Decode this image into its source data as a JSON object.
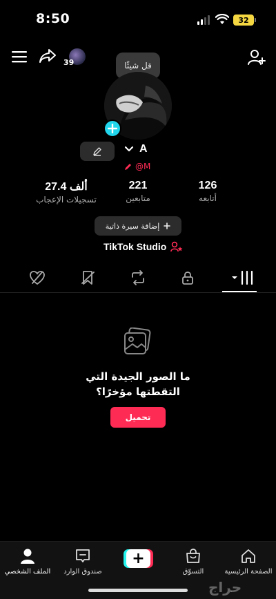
{
  "status_bar": {
    "time": "8:50",
    "battery": "32"
  },
  "top_bar": {
    "story_count": "39"
  },
  "note_bubble": "قل شيئًا",
  "profile": {
    "name": "A",
    "username": "@M"
  },
  "stats": {
    "following": {
      "value": "126",
      "label": "أتابعه"
    },
    "followers": {
      "value": "221",
      "label": "متابعين"
    },
    "likes": {
      "value": "27.4 ألف",
      "label": "تسجيلات الإعجاب"
    }
  },
  "bio_button": {
    "label": "إضافة سيرة ذاتية",
    "icon": "plus-icon"
  },
  "studio": {
    "label": "TikTok Studio"
  },
  "tabs": [
    "videos-grid-icon",
    "lock-icon",
    "repost-icon",
    "favorites-icon",
    "liked-icon"
  ],
  "empty_state": {
    "line1": "ما الصور الجيدة التي",
    "line2": "التقطتها مؤخرًا؟",
    "upload_label": "تحميل"
  },
  "bottom_nav": {
    "home": "الصفحة الرئيسية",
    "shop": "التسوّق",
    "inbox": "صندوق الوارد",
    "profile": "الملف الشخصي"
  },
  "watermark": "حراج",
  "colors": {
    "accent": "#fe2c55",
    "cyan": "#25f4ee",
    "battery": "#f5d742"
  }
}
